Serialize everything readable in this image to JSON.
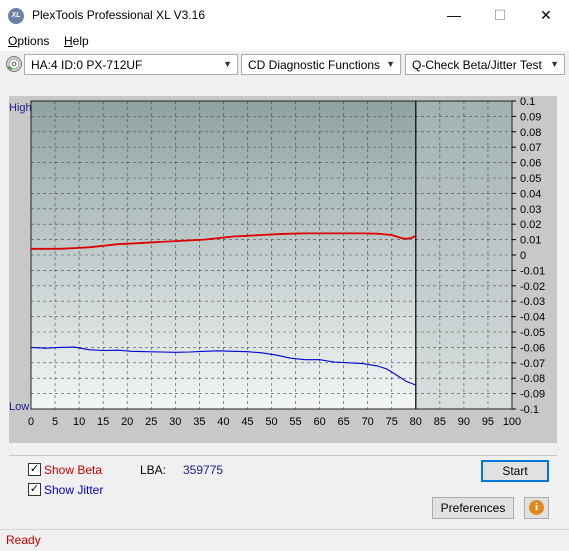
{
  "window": {
    "title": "PlexTools Professional XL V3.16",
    "icon_text": "XL",
    "minimize_glyph": "—",
    "maximize_glyph": "☐",
    "close_glyph": "✕"
  },
  "menu": {
    "items": [
      {
        "label": "Options",
        "mnemonic": "O",
        "rest": "ptions"
      },
      {
        "label": "Help",
        "mnemonic": "H",
        "rest": "elp"
      }
    ]
  },
  "toolbar": {
    "drive": "HA:4 ID:0  PX-712UF",
    "function": "CD Diagnostic Functions",
    "test": "Q-Check Beta/Jitter Test"
  },
  "chart_data": {
    "type": "line",
    "left_axis_labels": {
      "top": "High",
      "bottom": "Low"
    },
    "x_ticks": [
      0,
      5,
      10,
      15,
      20,
      25,
      30,
      35,
      40,
      45,
      50,
      55,
      60,
      65,
      70,
      75,
      80,
      85,
      90,
      95,
      100
    ],
    "y_ticks": [
      "0.1",
      "0.09",
      "0.08",
      "0.07",
      "0.06",
      "0.05",
      "0.04",
      "0.03",
      "0.02",
      "0.01",
      "0",
      "-0.01",
      "-0.02",
      "-0.03",
      "-0.04",
      "-0.05",
      "-0.06",
      "-0.07",
      "-0.08",
      "-0.09",
      "-0.1"
    ],
    "xlim": [
      0,
      100
    ],
    "ylim": [
      -0.1,
      0.1
    ],
    "test_end_x": 80,
    "grid": true,
    "colors": {
      "beta": "#dd0000",
      "jitter": "#0000cc",
      "plot_bg_top": "#8fa2a2",
      "plot_bg_bottom": "#f4f6f6",
      "tick_label": "#1c1c8c"
    },
    "series": [
      {
        "key": "beta",
        "x": [
          0,
          3,
          6,
          9,
          12,
          15,
          18,
          21,
          24,
          27,
          30,
          33,
          36,
          39,
          42,
          45,
          48,
          51,
          54,
          57,
          60,
          63,
          66,
          69,
          72,
          75,
          77,
          78,
          79,
          80
        ],
        "values": [
          0.004,
          0.004,
          0.004,
          0.0045,
          0.005,
          0.006,
          0.007,
          0.0075,
          0.008,
          0.0085,
          0.009,
          0.0095,
          0.01,
          0.011,
          0.012,
          0.0125,
          0.013,
          0.0135,
          0.0138,
          0.014,
          0.014,
          0.014,
          0.014,
          0.014,
          0.0138,
          0.013,
          0.011,
          0.0105,
          0.011,
          0.0125
        ]
      },
      {
        "key": "jitter",
        "x": [
          0,
          3,
          6,
          9,
          12,
          15,
          18,
          21,
          24,
          27,
          30,
          33,
          36,
          39,
          42,
          45,
          48,
          51,
          54,
          57,
          60,
          63,
          66,
          69,
          72,
          74,
          76,
          78,
          80
        ],
        "values": [
          -0.06,
          -0.0605,
          -0.06,
          -0.0598,
          -0.0615,
          -0.062,
          -0.0618,
          -0.0625,
          -0.0628,
          -0.063,
          -0.0632,
          -0.063,
          -0.0625,
          -0.0622,
          -0.0625,
          -0.0628,
          -0.0635,
          -0.065,
          -0.067,
          -0.068,
          -0.068,
          -0.0695,
          -0.07,
          -0.0705,
          -0.072,
          -0.074,
          -0.078,
          -0.082,
          -0.0845
        ]
      }
    ]
  },
  "options": {
    "show_beta": {
      "label": "Show Beta",
      "checked": true,
      "color": "#cc0000"
    },
    "show_jitter": {
      "label": "Show Jitter",
      "checked": true,
      "color": "#0000cc"
    },
    "check_glyph": "✓"
  },
  "lba": {
    "label": "LBA:",
    "value": "359775",
    "value_color": "#1c1c8c"
  },
  "buttons": {
    "start": "Start",
    "preferences": "Preferences",
    "info_glyph": "i"
  },
  "status": {
    "text": "Ready",
    "color": "#cc0000"
  }
}
